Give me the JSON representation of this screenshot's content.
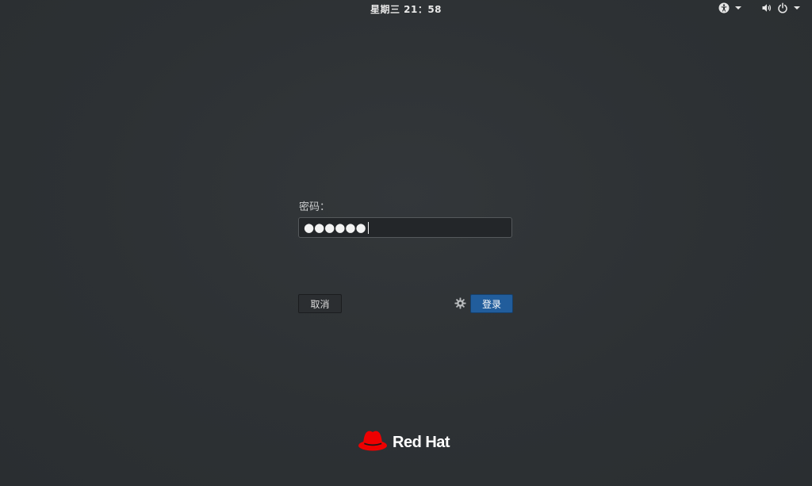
{
  "topbar": {
    "clock": "星期三 21：58",
    "icons": {
      "accessibility": "accessibility-icon",
      "volume": "volume-icon",
      "power": "power-icon"
    }
  },
  "login": {
    "password_label": "密码：",
    "password_value": "●●●●●●",
    "cancel_label": "取消",
    "login_label": "登录",
    "settings_icon": "gear-icon"
  },
  "brand": {
    "name": "Red Hat"
  },
  "colors": {
    "background": "#2c3033",
    "login_button": "#215d9c",
    "brand_red": "#ee0000"
  }
}
